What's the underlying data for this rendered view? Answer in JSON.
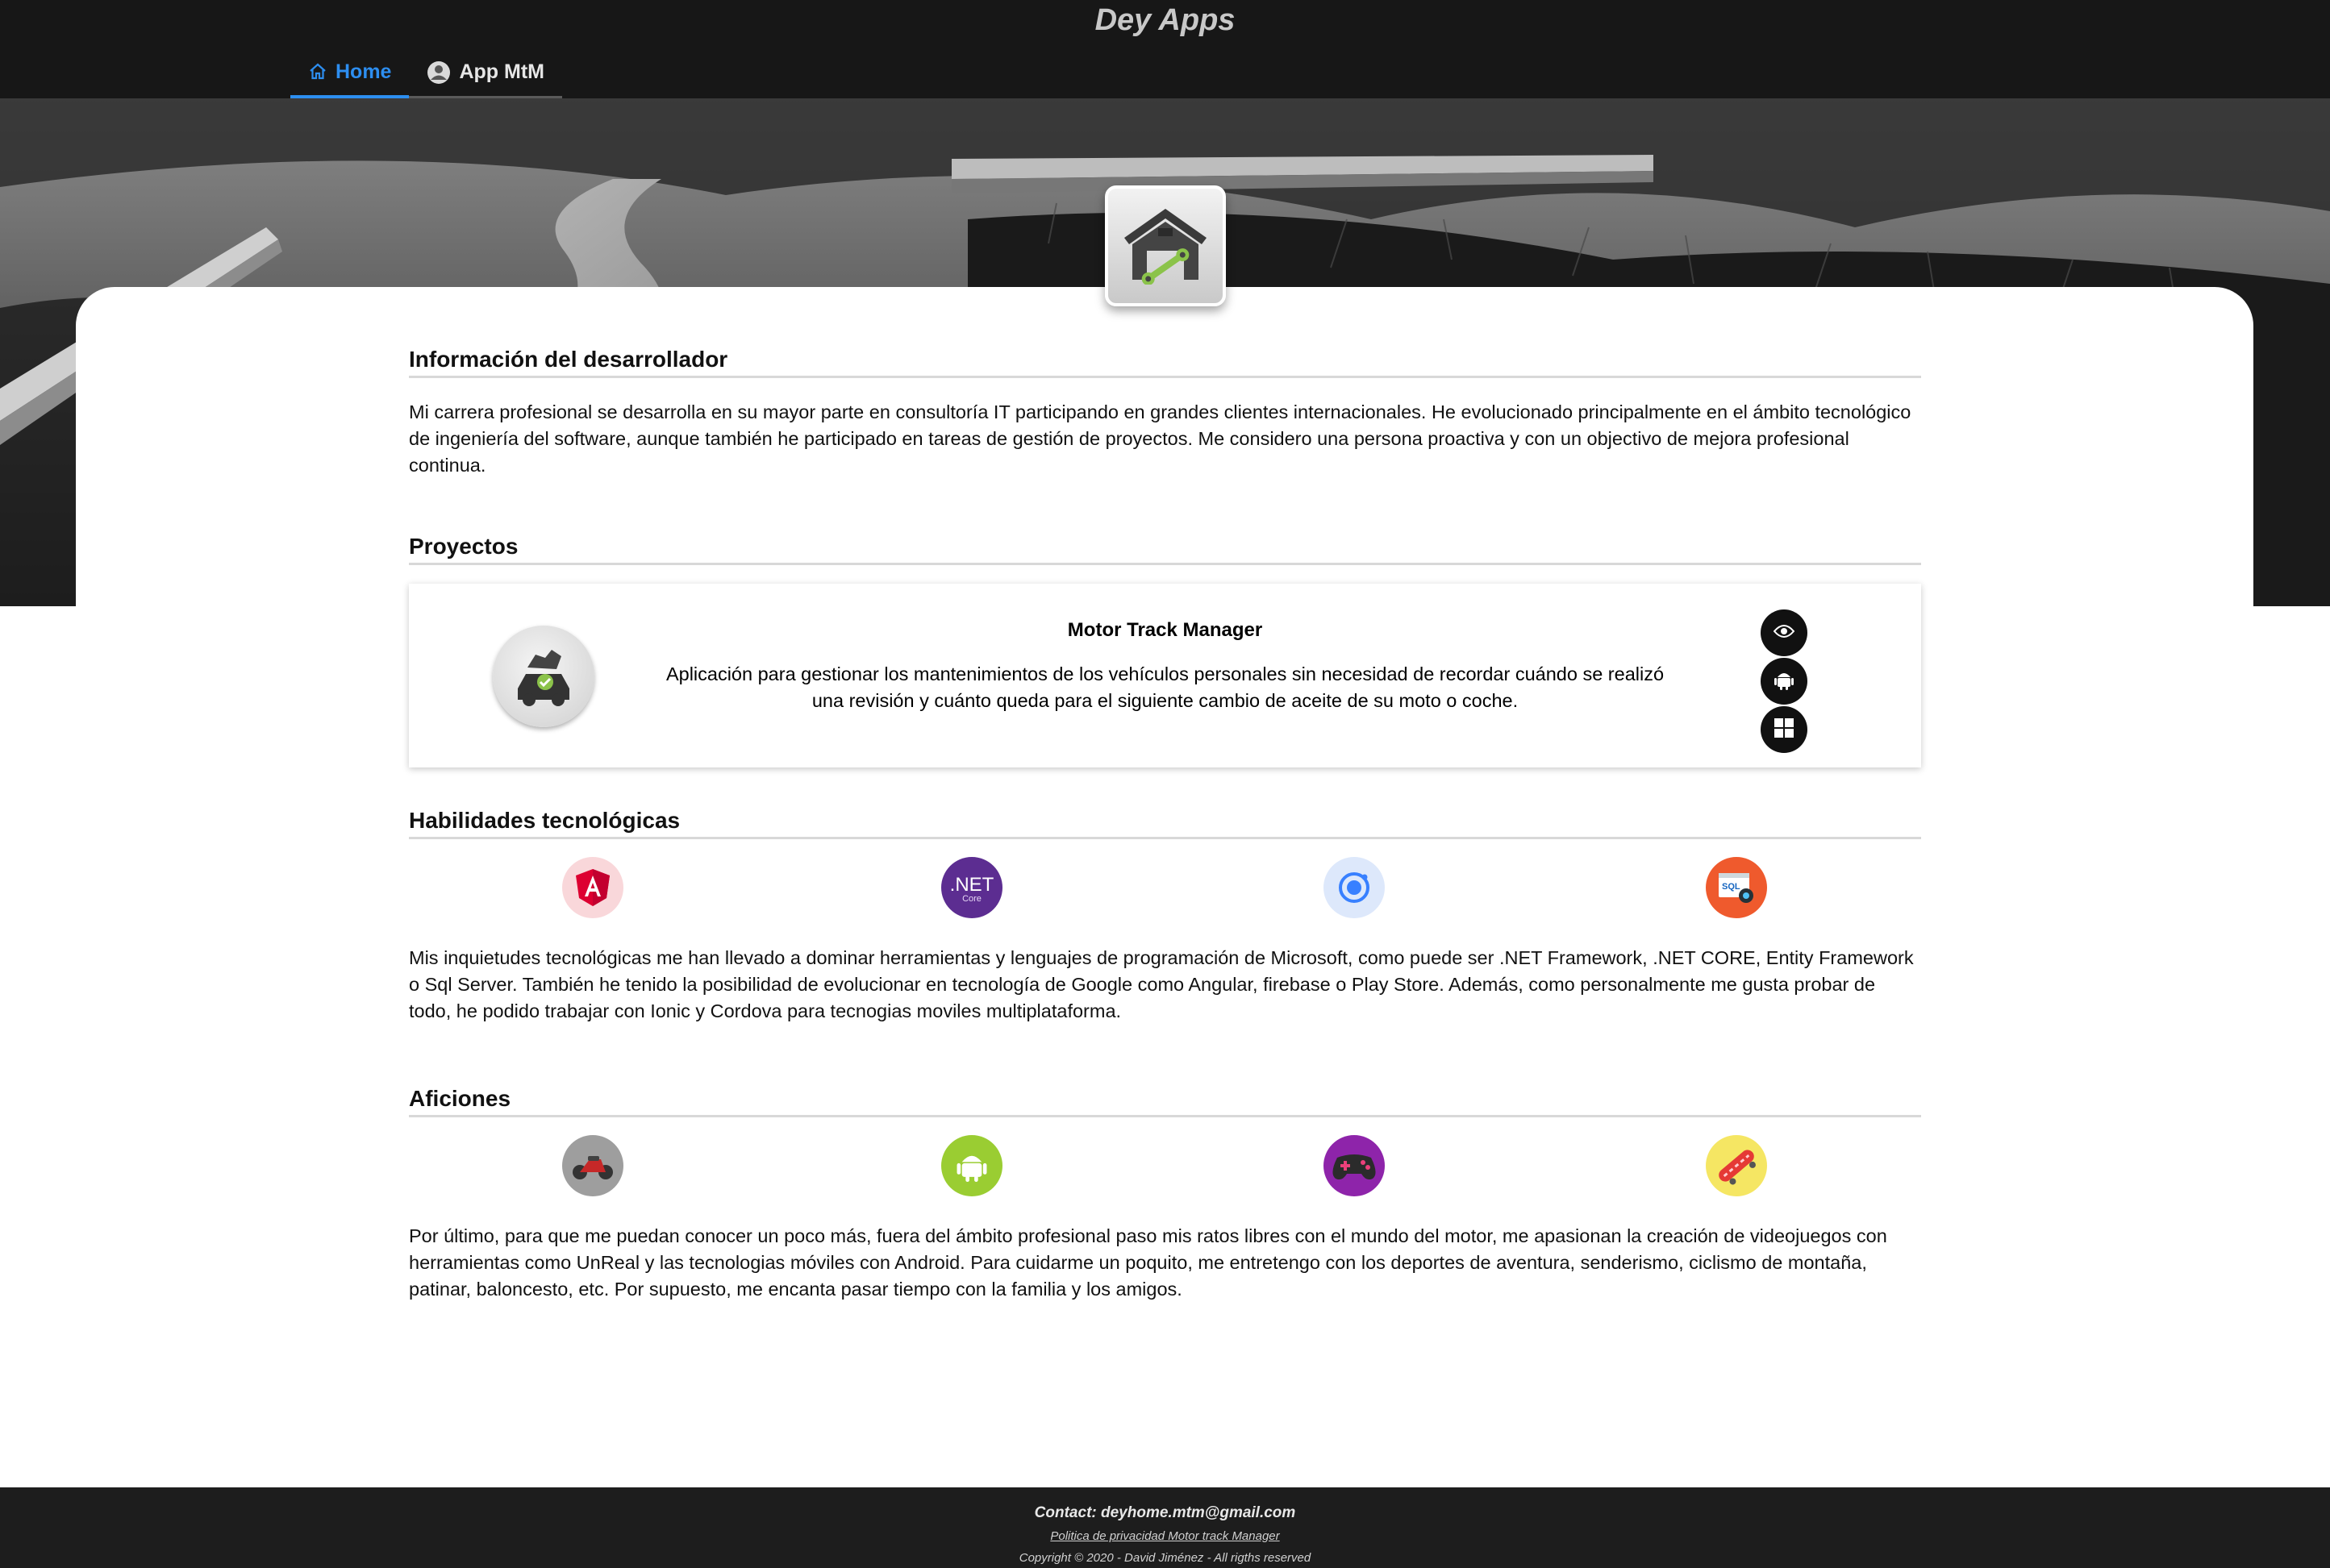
{
  "header": {
    "site_title": "Dey Apps",
    "tabs": [
      {
        "label": "Home",
        "icon": "home-icon",
        "active": true
      },
      {
        "label": "App MtM",
        "icon": "avatar-icon",
        "active": false
      }
    ]
  },
  "developer": {
    "title": "Información del desarrollador",
    "text": "Mi carrera profesional se desarrolla en su mayor parte en consultoría IT participando en grandes clientes internacionales. He evolucionado principalmente en el ámbito tecnológico de ingeniería del software, aunque también he participado en tareas de gestión de proyectos. Me considero una persona proactiva y con un objectivo de mejora profesional continua."
  },
  "projects": {
    "title": "Proyectos",
    "items": [
      {
        "name": "Motor Track Manager",
        "description": "Aplicación para gestionar los mantenimientos de los vehículos personales sin necesidad de recordar cuándo se realizó una revisión y cuánto queda para el siguiente cambio de aceite de su moto o coche.",
        "actions": [
          "eye-icon",
          "android-icon",
          "windows-icon"
        ]
      }
    ]
  },
  "skills": {
    "title": "Habilidades tecnológicas",
    "icons": [
      {
        "name": "angular-icon",
        "color": "#dd0031",
        "bg": "#f9d7da"
      },
      {
        "name": "dotnet-icon",
        "color": "#ffffff",
        "bg": "#5c2d91",
        "label": ".NET",
        "sublabel": "Core"
      },
      {
        "name": "ionic-icon",
        "color": "#3880ff",
        "bg": "#dde8fb"
      },
      {
        "name": "sql-server-icon",
        "color": "#ffffff",
        "bg": "#ef5a2d",
        "label": "SQL"
      }
    ],
    "text": "Mis inquietudes tecnológicas me han llevado a dominar herramientas y lenguajes de programación de Microsoft, como puede ser .NET Framework, .NET CORE, Entity Framework o Sql Server. También he tenido la posibilidad de evolucionar en tecnología de Google como Angular, firebase o Play Store. Además, como personalmente me gusta probar de todo, he podido trabajar con Ionic y Cordova para tecnogias moviles multiplataforma."
  },
  "hobbies": {
    "title": "Aficiones",
    "icons": [
      {
        "name": "motorcycle-icon",
        "bg": "#9e9e9e"
      },
      {
        "name": "android-icon",
        "bg": "#9acd32"
      },
      {
        "name": "gamepad-icon",
        "bg": "#8e24aa"
      },
      {
        "name": "skateboard-icon",
        "bg": "#f5e663"
      }
    ],
    "text": "Por último, para que me puedan conocer un poco más, fuera del ámbito profesional paso mis ratos libres con el mundo del motor, me apasionan la creación de videojuegos con herramientas como UnReal y las tecnologias móviles con Android. Para cuidarme un poquito, me entretengo con los deportes de aventura, senderismo, ciclismo de montaña, patinar, baloncesto, etc. Por supuesto, me encanta pasar tiempo con la familia y los amigos."
  },
  "footer": {
    "contact": "Contact: deyhome.mtm@gmail.com",
    "policy": "Politica de privacidad Motor track Manager",
    "copyright": "Copyright © 2020 - David Jiménez - All rigths reserved"
  },
  "colors": {
    "accent": "#2d8ef0",
    "header_bg": "#171717",
    "footer_bg": "#1d1d1d"
  }
}
